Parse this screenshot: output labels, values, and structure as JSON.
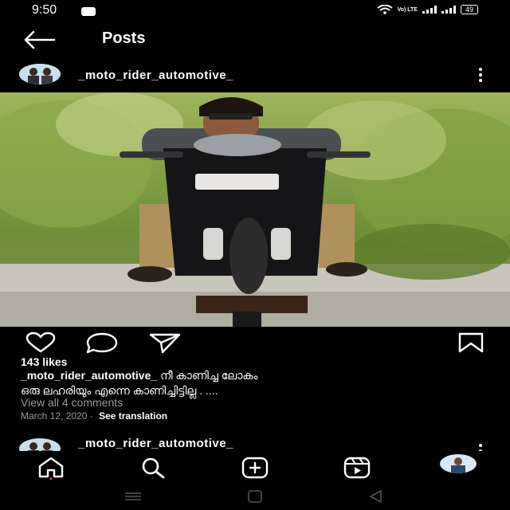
{
  "status": {
    "time": "9:50",
    "net_top": "Vo) LTE",
    "battery": "49"
  },
  "header": {
    "title": "Posts"
  },
  "post": {
    "username": "_moto_rider_automotive_",
    "likes": "143 likes",
    "caption_user": "_moto_rider_automotive_",
    "caption_text_line1": "നീ കാണിച്ച ലോകം",
    "caption_text_line2": "ഒരു ലഹരിയും എന്നെ കാണിച്ചിട്ടില്ല . ....",
    "view_comments": "View all 4 comments",
    "date": "March 12, 2020",
    "separator": "·",
    "see_translation": "See translation"
  },
  "next_post": {
    "username": "_moto_rider_automotive_"
  },
  "icons": {
    "back": "arrow-left-icon",
    "more": "more-vertical-icon",
    "like": "heart-icon",
    "comment": "comment-icon",
    "share": "send-icon",
    "save": "bookmark-icon",
    "home": "home-icon",
    "search": "search-icon",
    "add": "plus-square-icon",
    "reels": "reels-icon"
  }
}
